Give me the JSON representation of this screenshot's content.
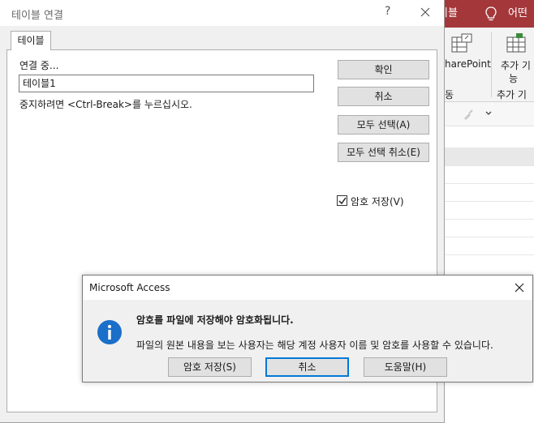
{
  "background_app": {
    "ribbon_tabs": [
      "이블",
      "어떤 작"
    ],
    "ribbon_items": [
      "harePoint",
      "추가 기",
      "능",
      "동",
      "추가 기능"
    ]
  },
  "link_dialog": {
    "title": "테이블 연결",
    "help_glyph": "?",
    "tab_label": "테이블",
    "status_label": "연결 중...",
    "progress_value": "테이블1",
    "hint": "중지하려면 <Ctrl-Break>를 누르십시오.",
    "buttons": {
      "ok": "확인",
      "cancel": "취소",
      "select_all": "모두 선택(A)",
      "deselect_all": "모두 선택 취소(E)"
    },
    "save_password": {
      "label": "암호 저장(V)",
      "checked": true
    }
  },
  "message_box": {
    "title": "Microsoft Access",
    "icon": "info-icon",
    "heading": "암호를 파일에 저장해야 암호화됩니다.",
    "text": "파일의 원본 내용을 보는 사용자는 해당 계정 사용자 이름 및 암호를 사용할 수 있습니다.",
    "buttons": {
      "save_password": "암호 저장(S)",
      "cancel": "취소",
      "help": "도움말(H)"
    }
  },
  "colors": {
    "ribbon_accent": "#a4373a",
    "focus_border": "#0078d7",
    "info_icon": "#1a6fc9"
  }
}
